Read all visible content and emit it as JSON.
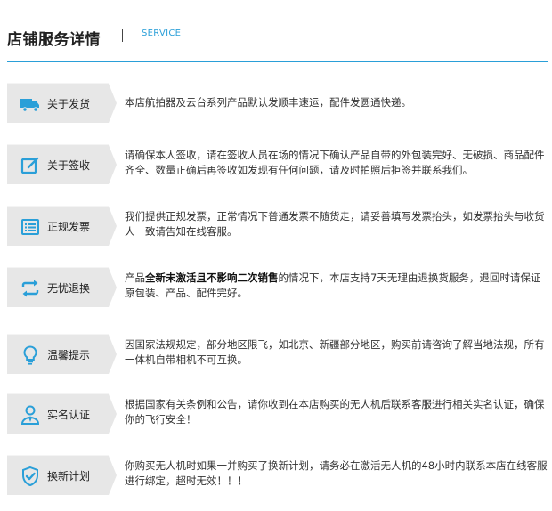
{
  "header": {
    "title": "店铺服务详情",
    "subtitle": "SERVICE"
  },
  "colors": {
    "accent": "#2a9fd8",
    "tag_bg": "#e7e7e7"
  },
  "rows": [
    {
      "icon": "truck-icon",
      "label": "关于发货",
      "text": "本店航拍器及云台系列产品默认发顺丰速运，配件发圆通快递。",
      "bold": "",
      "text_after": ""
    },
    {
      "icon": "edit-signature-icon",
      "label": "关于签收",
      "text": "请确保本人签收，请在签收人员在场的情况下确认产品自带的外包装完好、无破损、商品配件齐全、数量正确后再签收如发现有任何问题，请及时拍照后拒签并联系我们。",
      "bold": "",
      "text_after": ""
    },
    {
      "icon": "invoice-list-icon",
      "label": "正规发票",
      "text": "我们提供正规发票，正常情况下普通发票不随货走，请妥善填写发票抬头，如发票抬头与收货人一致请告知在线客服。",
      "bold": "",
      "text_after": ""
    },
    {
      "icon": "exchange-arrows-icon",
      "label": "无忧退换",
      "text": "产品",
      "bold": "全新未激活且不影响二次销售",
      "text_after": "的情况下，本店支持7天无理由退换货服务，退回时请保证原包装、产品、配件完好。"
    },
    {
      "icon": "lightbulb-icon",
      "label": "温馨提示",
      "text": "因国家法规规定，部分地区限飞，如北京、新疆部分地区，购买前请咨询了解当地法规，所有一体机自带相机不可互换。",
      "bold": "",
      "text_after": ""
    },
    {
      "icon": "user-verify-icon",
      "label": "实名认证",
      "text": "根据国家有关条例和公告，请你收到在本店购买的无人机后联系客服进行相关实名认证，确保你的飞行安全！",
      "bold": "",
      "text_after": ""
    },
    {
      "icon": "shield-check-icon",
      "label": "换新计划",
      "text": "你购买无人机时如果一并购买了换新计划，请务必在激活无人机的48小时内联系本店在线客服进行绑定，超时无效！！！",
      "bold": "",
      "text_after": ""
    }
  ]
}
